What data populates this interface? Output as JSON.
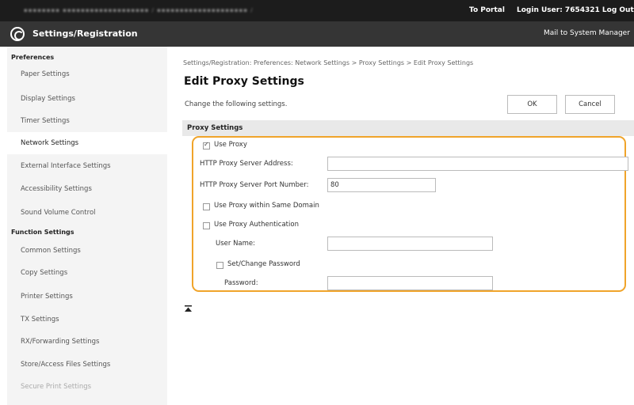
{
  "topbar": {
    "url": "▪▪▪▪▪▪▪▪  ▪▪▪▪▪▪▪▪▪▪▪▪▪▪▪▪▪▪▪ / ▪▪▪▪▪▪▪▪▪▪▪▪▪▪▪▪▪▪▪▪ /",
    "portal": "To Portal",
    "login": "Login User:  7654321  Log Out"
  },
  "titlebar": {
    "title": "Settings/Registration",
    "mail": "Mail to System Manager"
  },
  "sidebar": {
    "preferences_header": "Preferences",
    "preferences_items": [
      "Paper Settings",
      "Display Settings",
      "Timer Settings",
      "Network Settings",
      "External Interface Settings",
      "Accessibility Settings",
      "Sound Volume Control"
    ],
    "function_header": "Function Settings",
    "function_items": [
      "Common Settings",
      "Copy Settings",
      "Printer Settings",
      "TX Settings",
      "RX/Forwarding Settings",
      "Store/Access Files Settings",
      "Secure Print Settings"
    ],
    "active_item": "Network Settings"
  },
  "main": {
    "breadcrumb": "Settings/Registration: Preferences: Network Settings > Proxy Settings > Edit Proxy Settings",
    "heading": "Edit Proxy Settings",
    "instruction": "Change the following settings.",
    "ok_label": "OK",
    "cancel_label": "Cancel",
    "section_header": "Proxy Settings",
    "use_proxy_label": "Use Proxy",
    "use_proxy_checked": true,
    "server_address_label": "HTTP Proxy Server Address:",
    "server_address_value": "",
    "port_label": "HTTP Proxy Server Port Number:",
    "port_value": "80",
    "same_domain_label": "Use Proxy within Same Domain",
    "same_domain_checked": false,
    "auth_label": "Use Proxy Authentication",
    "auth_checked": false,
    "user_name_label": "User Name:",
    "user_name_value": "",
    "set_password_label": "Set/Change Password",
    "set_password_checked": false,
    "password_label": "Password:",
    "password_value": ""
  },
  "colors": {
    "highlight_frame": "#f0a42a",
    "topbar_bg": "#1c1c1c",
    "titlebar_bg": "#353535"
  }
}
